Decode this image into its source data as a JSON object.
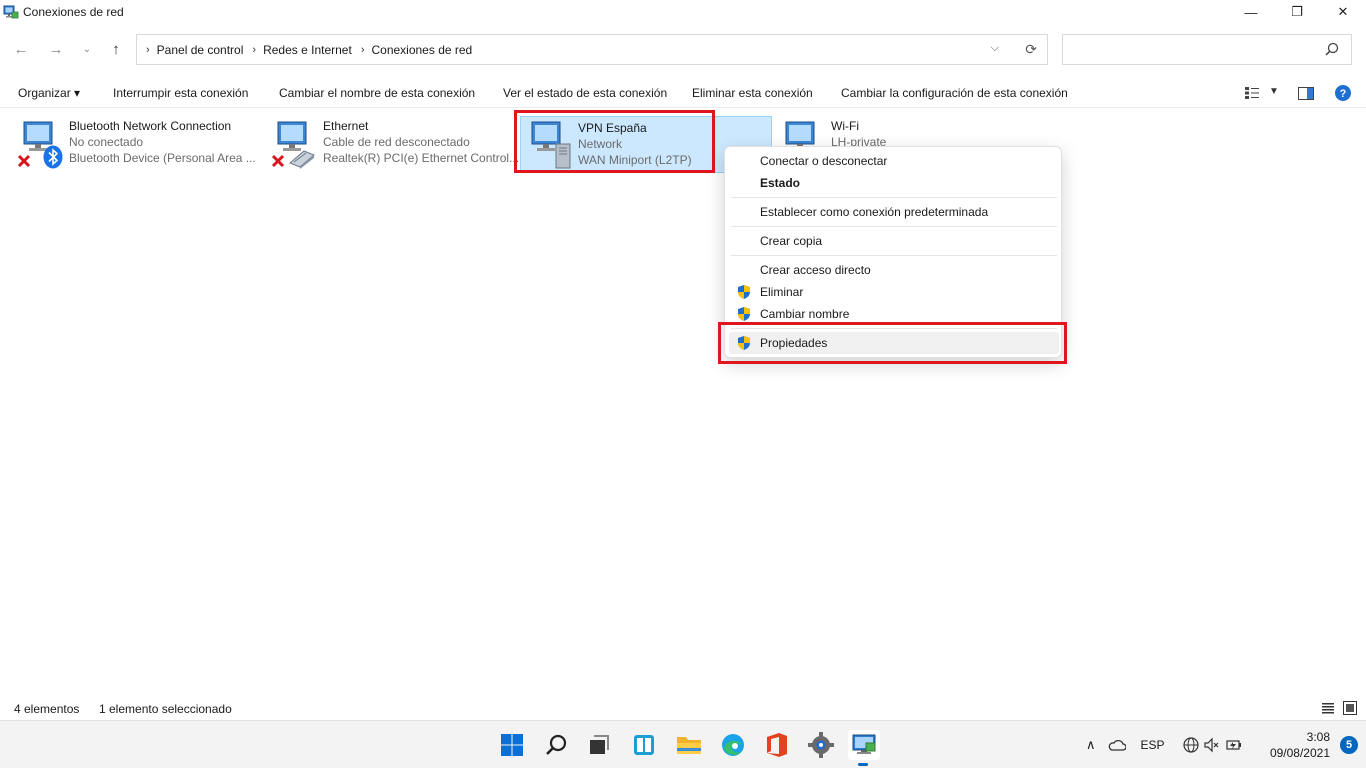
{
  "window": {
    "title": "Conexiones de red",
    "controls": {
      "minimize": "—",
      "maximize": "❐",
      "close": "✕"
    }
  },
  "address": {
    "crumbs": [
      "Panel de control",
      "Redes e Internet",
      "Conexiones de red"
    ],
    "search_placeholder": ""
  },
  "toolbar": {
    "organize": "Organizar ▾",
    "disconnect": "Interrumpir esta conexión",
    "rename": "Cambiar el nombre de esta conexión",
    "status": "Ver el estado de esta conexión",
    "delete": "Eliminar esta conexión",
    "change_settings": "Cambiar la configuración de esta conexión"
  },
  "connections": [
    {
      "name": "Bluetooth Network Connection",
      "status": "No conectado",
      "device": "Bluetooth Device (Personal Area ..."
    },
    {
      "name": "Ethernet",
      "status": "Cable de red desconectado",
      "device": "Realtek(R) PCI(e) Ethernet Control..."
    },
    {
      "name": "VPN España",
      "status": "Network",
      "device": "WAN Miniport (L2TP)"
    },
    {
      "name": "Wi-Fi",
      "status": "LH-private",
      "device": ""
    }
  ],
  "context_menu": {
    "connect": "Conectar o desconectar",
    "status": "Estado",
    "set_default": "Establecer como conexión predeterminada",
    "copy": "Crear copia",
    "shortcut": "Crear acceso directo",
    "delete": "Eliminar",
    "rename": "Cambiar nombre",
    "properties": "Propiedades"
  },
  "statusbar": {
    "count": "4 elementos",
    "selected": "1 elemento seleccionado"
  },
  "taskbar": {
    "language": "ESP",
    "time": "3:08",
    "date": "09/08/2021",
    "notifications": "5"
  },
  "colors": {
    "highlight_red": "#e0161e",
    "selection_bg": "#cce8ff",
    "accent": "#0067c0"
  }
}
